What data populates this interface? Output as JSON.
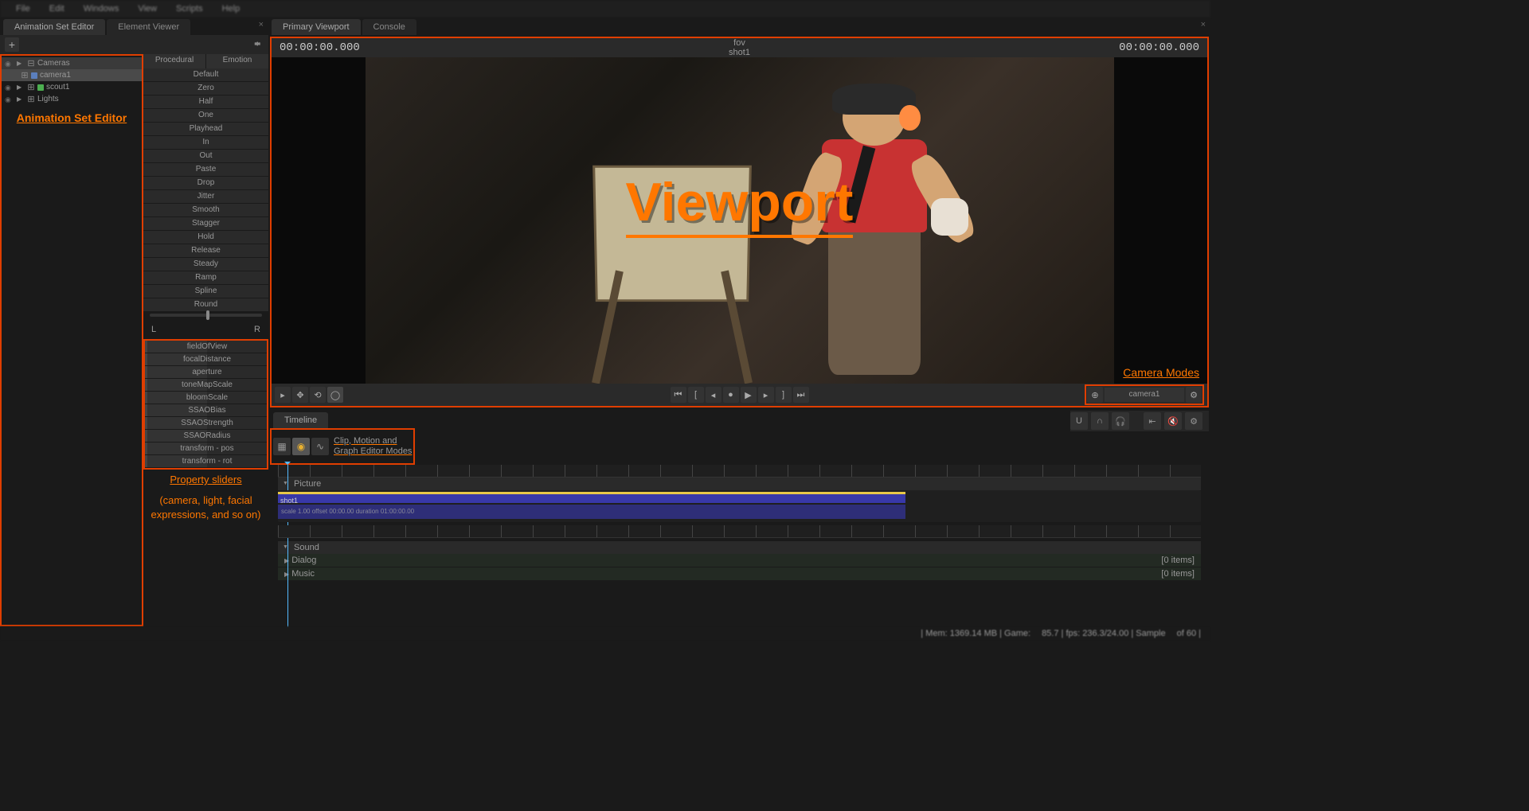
{
  "menu": {
    "items": [
      "File",
      "Edit",
      "Windows",
      "View",
      "Scripts",
      "Help"
    ]
  },
  "leftTabs": {
    "a": "Animation Set Editor",
    "b": "Element Viewer"
  },
  "tree": {
    "items": [
      {
        "label": "Cameras",
        "sel": true,
        "depth": 0,
        "ico": ""
      },
      {
        "label": "camera1",
        "sel": true,
        "depth": 1,
        "ico": "cam"
      },
      {
        "label": "scout1",
        "sel": false,
        "depth": 0,
        "ico": "mdl"
      },
      {
        "label": "Lights",
        "sel": false,
        "depth": 0,
        "ico": ""
      }
    ]
  },
  "annoASE": "Animation Set Editor",
  "presetTabs": {
    "a": "Procedural",
    "b": "Emotion"
  },
  "presets": [
    "Default",
    "Zero",
    "Half",
    "One",
    "Playhead",
    "In",
    "Out",
    "Paste",
    "Drop",
    "Jitter",
    "Smooth",
    "Stagger",
    "Hold",
    "Release",
    "Steady",
    "Ramp",
    "Spline",
    "Round"
  ],
  "lr": {
    "l": "L",
    "r": "R"
  },
  "props": [
    "fieldOfView",
    "focalDistance",
    "aperture",
    "toneMapScale",
    "bloomScale",
    "SSAOBias",
    "SSAOStrength",
    "SSAORadius",
    "transform - pos",
    "transform - rot"
  ],
  "annoProps": {
    "a": "Property sliders",
    "b": "(camera, light, facial expressions, and so on)"
  },
  "rightTabs": {
    "a": "Primary Viewport",
    "b": "Console"
  },
  "viewport": {
    "tcLeft": "00:00:00.000",
    "tcRight": "00:00:00.000",
    "titleTop": "fov",
    "titleBot": "shot1",
    "overlay": "Viewport",
    "camAnno": "Camera Modes",
    "camName": "camera1"
  },
  "timeline": {
    "tab": "Timeline",
    "anno1": "Clip, Motion and",
    "anno2": "Graph Editor Modes",
    "picture": "Picture",
    "shot": "shot1",
    "clipInfo": "scale 1.00 offset 00:00.00 duration 01:00:00.00",
    "sound": "Sound",
    "dialog": "Dialog",
    "dialogCount": "[0 items]",
    "music": "Music",
    "musicCount": "[0 items]"
  },
  "status": {
    "mem": "| Mem: 1369.14 MB | Game:",
    "fps": "85.7 | fps: 236.3/24.00 | Sample",
    "end": "of 60 |"
  }
}
